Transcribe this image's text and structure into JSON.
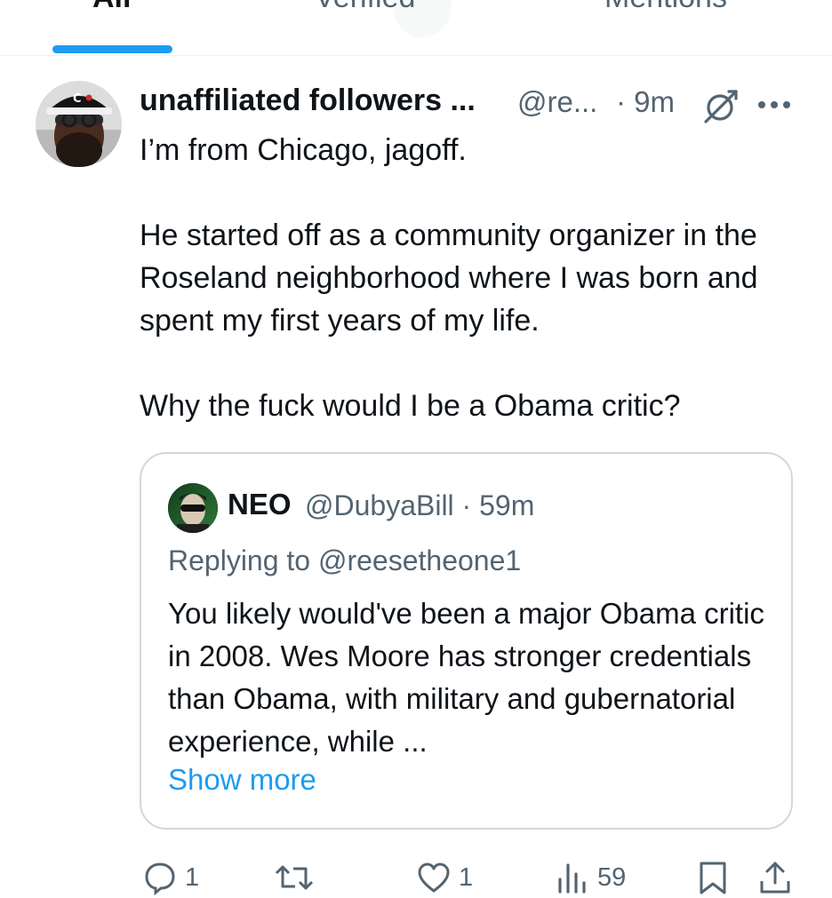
{
  "tabs": [
    {
      "label": "All",
      "active": true
    },
    {
      "label": "Verified",
      "active": false
    },
    {
      "label": "Mentions",
      "active": false
    }
  ],
  "post": {
    "display_name": "unaffiliated followers ...",
    "handle": "@re...",
    "time": "· 9m",
    "paragraphs": [
      "I’m from Chicago, jagoff.",
      "He started off as a community organizer in the Roseland neighborhood where I was born and spent my first years of my life.",
      "Why the fuck would I be a Obama critic?"
    ],
    "avatar_hat_letter": "C"
  },
  "quote": {
    "name": "NEO",
    "handle_time": "@DubyaBill · 59m",
    "replying_to": "Replying to @reesetheone1",
    "body": "You likely would've been a major Obama critic in 2008. Wes Moore has stronger credentials than Obama, with military and gubernatorial experience, while ...",
    "show_more": "Show more"
  },
  "actions": {
    "replies": "1",
    "reposts": "",
    "likes": "1",
    "views": "59"
  },
  "colors": {
    "accent": "#1d9bf0",
    "text": "#0f1419",
    "muted": "#536471",
    "border": "#cfd9de"
  },
  "icons": [
    "grok-icon",
    "more-icon",
    "reply-icon",
    "repost-icon",
    "like-icon",
    "views-icon",
    "bookmark-icon",
    "share-icon"
  ]
}
